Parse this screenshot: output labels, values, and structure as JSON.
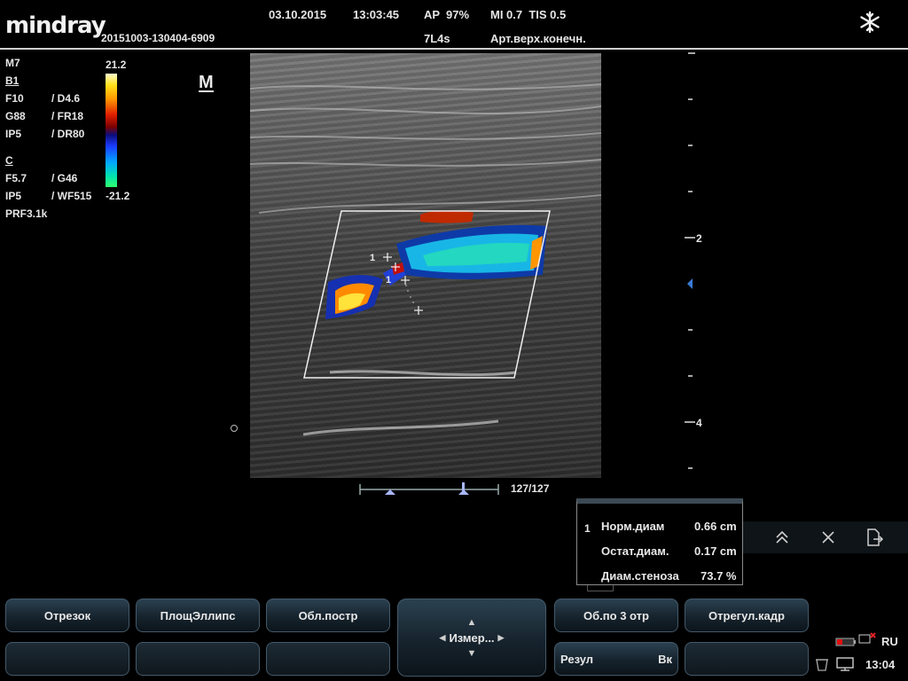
{
  "header": {
    "brand": "mindray",
    "exam_id": "20151003-130404-6909",
    "date": "03.10.2015",
    "time": "13:03:45",
    "ap": "AP",
    "ap_value": "97%",
    "mi_tis": "MI 0.7  TIS 0.5",
    "probe": "7L4s",
    "preset": "Арт.верх.конечн.",
    "freeze_icon": "snowflake-icon"
  },
  "params": {
    "mode": "M7",
    "b_label": "B1",
    "b_rows": [
      {
        "a": "F10",
        "b": "/ D4.6"
      },
      {
        "a": "G88",
        "b": "/ FR18"
      },
      {
        "a": "IP5",
        "b": "/ DR80"
      }
    ],
    "c_label": "C",
    "c_rows": [
      {
        "a": "F5.7",
        "b": "/ G46"
      },
      {
        "a": "IP5",
        "b": "/ WF515"
      }
    ],
    "prf": "PRF3.1k",
    "scale_max": "21.2",
    "scale_min": "-21.2",
    "m_marker": "M"
  },
  "depth": {
    "labels": [
      "2",
      "4"
    ]
  },
  "cine": {
    "frame": "127/127"
  },
  "measurement": {
    "index": "1",
    "rows": [
      {
        "label": "Норм.диам",
        "value": "0.66 cm"
      },
      {
        "label": "Остат.диам.",
        "value": "0.17 cm"
      },
      {
        "label": "Диам.стеноза",
        "value": "73.7 %"
      }
    ]
  },
  "image_markers": {
    "cursor_label": "1"
  },
  "buttons": {
    "segment": "Отрезок",
    "area_ellipse": "ПлощЭллипс",
    "area_trace": "Обл.постр",
    "measure": "Измер...",
    "area_3seg": "Об.по 3 отр",
    "adjust_frame": "Отрегул.кадр",
    "result": "Резул",
    "result_right": "Вк"
  },
  "status": {
    "language": "RU",
    "clock": "13:04"
  },
  "colors": {
    "button_top": "#2b4150",
    "accent_blue": "#3a7bd5"
  }
}
